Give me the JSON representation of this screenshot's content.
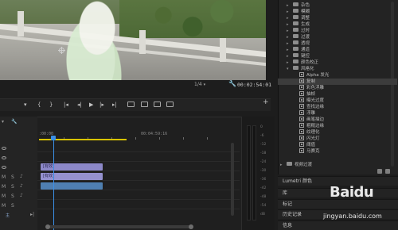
{
  "program_monitor": {
    "zoom": "1/4",
    "duration_timecode": "00:02:54:01"
  },
  "timeline": {
    "ruler_start": ":00:00",
    "ruler_mid": "00:04:59:16",
    "clip_v1_label": "[有效]",
    "clip_v2_label": "[有效]",
    "clip_a1_label": "",
    "track_a_labels": [
      "A1",
      "A2",
      "A3"
    ],
    "track_v_labels": [
      "V3",
      "V2",
      "V1"
    ],
    "master": "主"
  },
  "effects_panel": {
    "items": [
      {
        "label": "杂色",
        "type": "folder",
        "indent": 1
      },
      {
        "label": "模糊",
        "type": "folder",
        "indent": 1
      },
      {
        "label": "调整",
        "type": "folder",
        "indent": 1
      },
      {
        "label": "生成",
        "type": "folder",
        "indent": 1
      },
      {
        "label": "过时",
        "type": "folder",
        "indent": 1
      },
      {
        "label": "过渡",
        "type": "folder",
        "indent": 1
      },
      {
        "label": "透视",
        "type": "folder",
        "indent": 1
      },
      {
        "label": "通道",
        "type": "folder",
        "indent": 1
      },
      {
        "label": "键控",
        "type": "folder",
        "indent": 1
      },
      {
        "label": "颜色校正",
        "type": "folder",
        "indent": 1
      },
      {
        "label": "风格化",
        "type": "folder-open",
        "indent": 1
      },
      {
        "label": "Alpha 发光",
        "type": "effect",
        "indent": 2
      },
      {
        "label": "复制",
        "type": "effect",
        "indent": 2,
        "selected": true
      },
      {
        "label": "彩色浮雕",
        "type": "effect",
        "indent": 2
      },
      {
        "label": "抽帧",
        "type": "effect",
        "indent": 2
      },
      {
        "label": "曝光过度",
        "type": "effect",
        "indent": 2
      },
      {
        "label": "查找边缘",
        "type": "effect",
        "indent": 2
      },
      {
        "label": "浮雕",
        "type": "effect",
        "indent": 2
      },
      {
        "label": "画笔描边",
        "type": "effect",
        "indent": 2
      },
      {
        "label": "粗糙边缘",
        "type": "effect",
        "indent": 2
      },
      {
        "label": "纹理化",
        "type": "effect",
        "indent": 2
      },
      {
        "label": "闪光灯",
        "type": "effect",
        "indent": 2
      },
      {
        "label": "阈值",
        "type": "effect",
        "indent": 2
      },
      {
        "label": "马赛克",
        "type": "effect",
        "indent": 2
      },
      {
        "label": "视频过渡",
        "type": "folder",
        "indent": 0
      }
    ]
  },
  "bottom_panels": {
    "lumetri": "Lumetri 颜色",
    "library": "库",
    "markers": "标记",
    "history": "历史记录",
    "info": "信息"
  },
  "meters": {
    "scale": [
      "0",
      "-6",
      "-12",
      "-18",
      "-24",
      "-30",
      "-36",
      "-42",
      "-48",
      "-54",
      "dB"
    ]
  },
  "watermark": {
    "logo": "Baidu",
    "url": "jingyan.baidu.com"
  },
  "colors": {
    "playhead": "#3b8fe6",
    "work_area": "#d9c300",
    "video_clip": "#8c88c8",
    "audio_clip": "#4f7fb1"
  }
}
